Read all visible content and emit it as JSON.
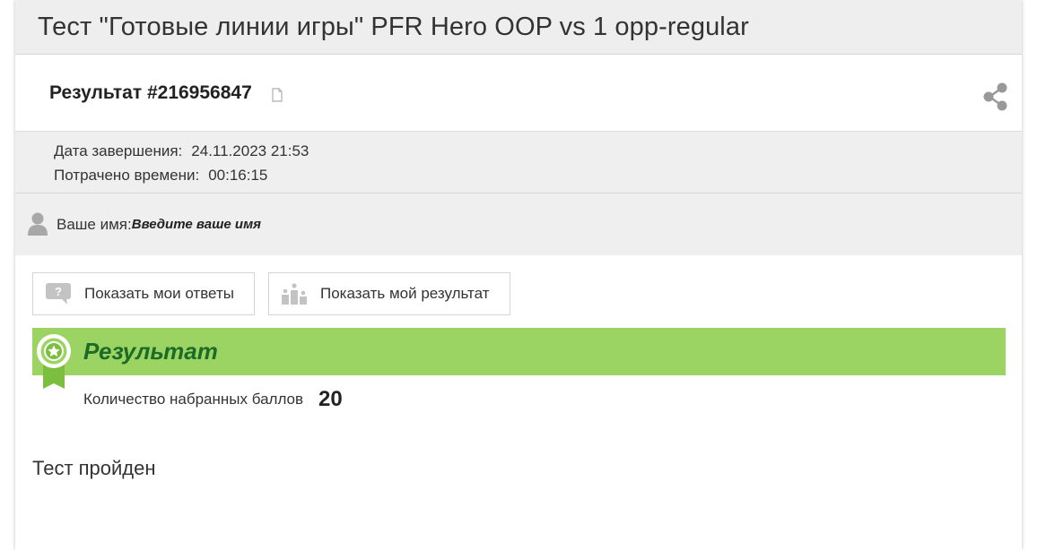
{
  "page_title": "Тест \"Готовые линии игры\" PFR Hero OOP vs 1 opp-regular",
  "result": {
    "title": "Результат #216956847"
  },
  "meta": {
    "finish_label": "Дата завершения:",
    "finish_value": "24.11.2023 21:53",
    "time_label": "Потрачено времени:",
    "time_value": "00:16:15"
  },
  "user": {
    "name_label": "Ваше имя:",
    "name_placeholder": "Введите ваше имя"
  },
  "buttons": {
    "show_answers": "Показать мои ответы",
    "show_result": "Показать мой результат"
  },
  "result_section": {
    "heading": "Результат",
    "score_label": "Количество набранных баллов",
    "score_value": "20",
    "status": "Тест пройден"
  },
  "colors": {
    "banner": "#9bd462",
    "banner_text": "#1d6b28",
    "header_bg": "#eeeeee"
  },
  "icons": {
    "copy": "copy-icon",
    "share": "share-icon",
    "user": "user-icon",
    "answers": "question-bubble-icon",
    "result": "podium-icon",
    "badge": "award-badge-icon"
  }
}
